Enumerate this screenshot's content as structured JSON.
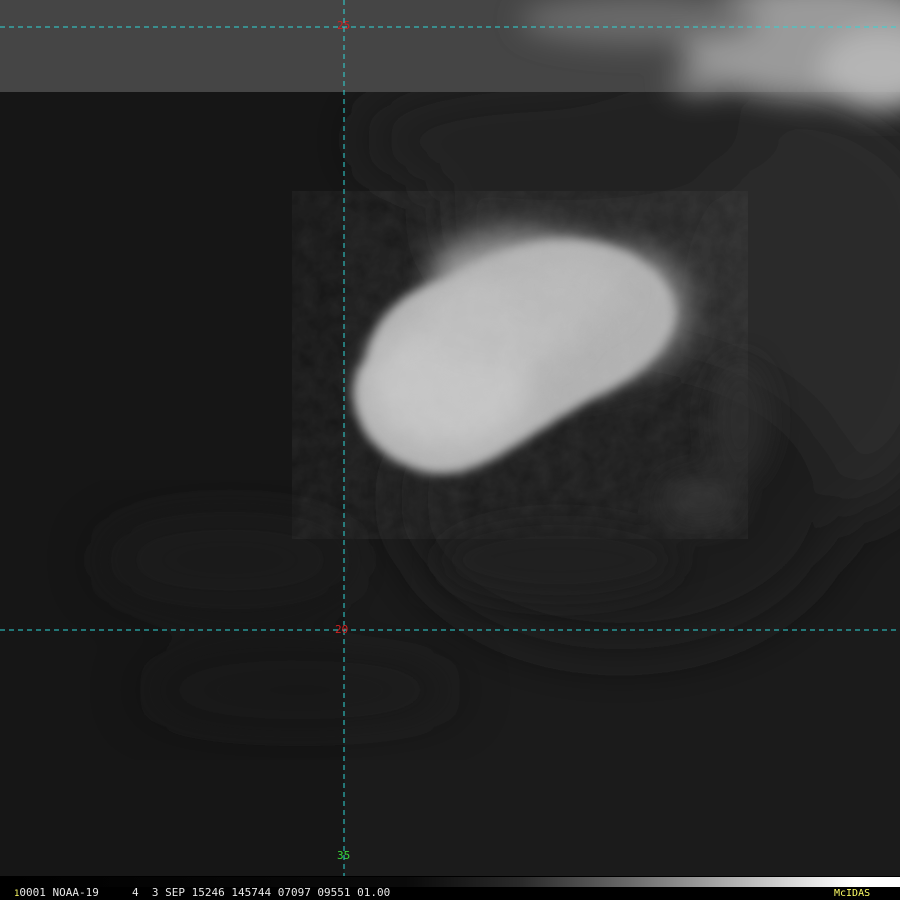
{
  "grid": {
    "lat_top": "25",
    "lat_mid": "20",
    "lon_bottom": "35",
    "line_color": "#2fd6d6",
    "lat_color": "#d22020",
    "lon_color": "#38d838"
  },
  "info": {
    "tick": "1",
    "caption": "0001 NOAA-19     4  3 SEP 15246 145744 07097 09551 01.00",
    "logo": "McIDAS",
    "logo_color": "#ffff66"
  }
}
